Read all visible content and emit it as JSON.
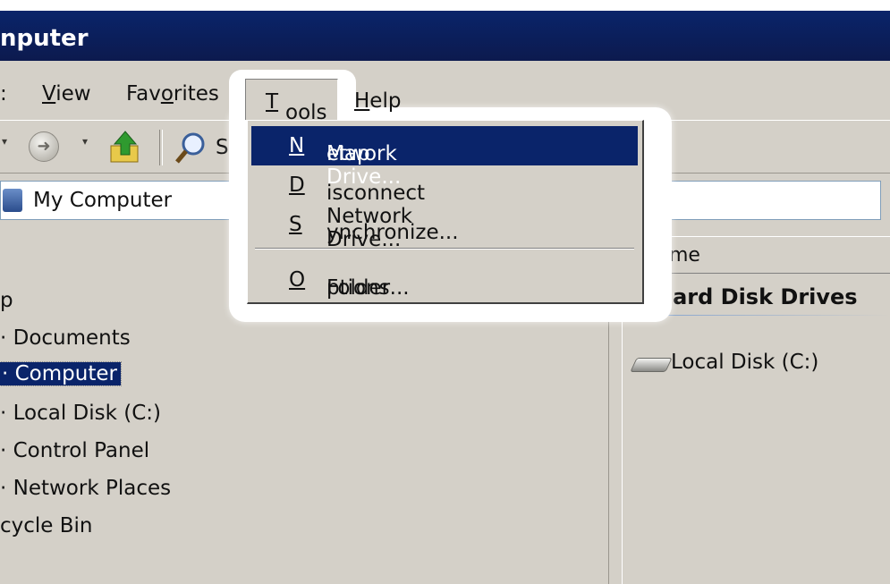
{
  "window": {
    "title": "nputer"
  },
  "menubar": {
    "items": [
      {
        "id": "file",
        "label": ":"
      },
      {
        "id": "view",
        "pre": "",
        "accel": "V",
        "post": "iew"
      },
      {
        "id": "favorites",
        "pre": "Fav",
        "accel": "o",
        "post": "rites"
      },
      {
        "id": "tools",
        "pre": "",
        "accel": "T",
        "post": "ools"
      },
      {
        "id": "help",
        "pre": "",
        "accel": "H",
        "post": "elp"
      }
    ]
  },
  "toolbar": {
    "search_label": "Se"
  },
  "addressbar": {
    "value": "My Computer"
  },
  "tree": {
    "items": [
      {
        "label": "p"
      },
      {
        "label": "Documents"
      },
      {
        "label": "Computer",
        "selected": true
      },
      {
        "label": "Local Disk (C:)"
      },
      {
        "label": "Control Panel"
      },
      {
        "label": "Network Places"
      },
      {
        "label": "cycle Bin"
      }
    ]
  },
  "details": {
    "column_name": "Name",
    "group_heading": "Hard Disk Drives",
    "drive_label": "Local Disk (C:)"
  },
  "tools_menu": {
    "items": [
      {
        "pre": "Map ",
        "accel": "N",
        "post": "etwork Drive...",
        "highlighted": true
      },
      {
        "pre": "",
        "accel": "D",
        "post": "isconnect Network Drive..."
      },
      {
        "pre": "",
        "accel": "S",
        "post": "ynchronize..."
      },
      {
        "pre": "Folder ",
        "accel": "O",
        "post": "ptions..."
      }
    ]
  },
  "colors": {
    "titlebar": "#0a246a",
    "selection": "#0a246a",
    "chrome": "#d4d0c8",
    "spotlight": "#ffffff"
  }
}
